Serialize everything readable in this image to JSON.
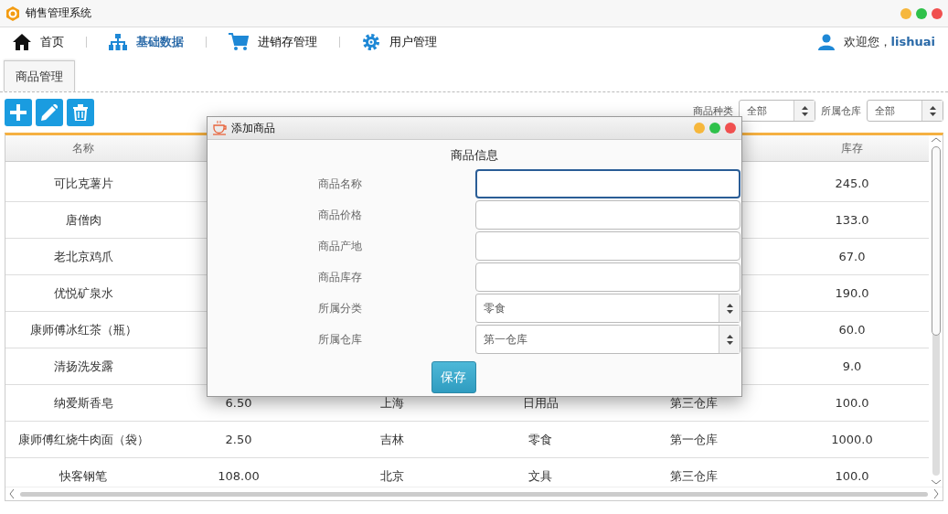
{
  "window": {
    "title": "销售管理系统"
  },
  "nav": [
    {
      "label": "首页",
      "selected": false
    },
    {
      "label": "基础数据",
      "selected": true
    },
    {
      "label": "进销存管理",
      "selected": false
    },
    {
      "label": "用户管理",
      "selected": false
    }
  ],
  "user": {
    "greeting": "欢迎您，",
    "name": "lishuai"
  },
  "tabs": [
    {
      "label": "商品管理",
      "selected": true
    }
  ],
  "toolbar": [
    {
      "kind": "add"
    },
    {
      "kind": "edit"
    },
    {
      "kind": "delete"
    }
  ],
  "filters": [
    {
      "label": "商品种类",
      "value": "全部"
    },
    {
      "label": "所属仓库",
      "value": "全部"
    }
  ],
  "table": {
    "header": {
      "column_1": "名称",
      "column_6": "库存"
    },
    "rows": [
      {
        "column_1": "可比克薯片",
        "column_6": "245.0"
      },
      {
        "column_1": "唐僧肉",
        "column_6": "133.0"
      },
      {
        "column_1": "老北京鸡爪",
        "column_6": "67.0"
      },
      {
        "column_1": "优悦矿泉水",
        "column_6": "190.0"
      },
      {
        "column_1": "康师傅冰红茶（瓶）",
        "column_6": "60.0"
      },
      {
        "column_1": "清扬洗发露",
        "column_6": "9.0"
      },
      {
        "column_1": "纳爱斯香皂",
        "column_2": "6.50",
        "column_3": "上海",
        "column_4": "日用品",
        "column_5": "第三仓库",
        "column_6": "100.0"
      },
      {
        "column_1": "康师傅红烧牛肉面（袋）",
        "column_2": "2.50",
        "column_3": "吉林",
        "column_4": "零食",
        "column_5": "第一仓库",
        "column_6": "1000.0"
      },
      {
        "column_1": "快客钢笔",
        "column_2": "108.00",
        "column_3": "北京",
        "column_4": "文具",
        "column_5": "第三仓库",
        "column_6": "100.0"
      }
    ]
  },
  "dialog": {
    "title": "添加商品",
    "heading": "商品信息",
    "fields": [
      {
        "kind": "text",
        "label": "商品名称",
        "focused": true
      },
      {
        "kind": "text",
        "label": "商品价格",
        "focused": false
      },
      {
        "kind": "text",
        "label": "商品产地",
        "focused": false
      },
      {
        "kind": "text",
        "label": "商品库存",
        "focused": false
      },
      {
        "kind": "select",
        "label": "所属分类",
        "value": "零食"
      },
      {
        "kind": "select",
        "label": "所属仓库",
        "value": "第一仓库"
      }
    ],
    "button": "保存"
  }
}
